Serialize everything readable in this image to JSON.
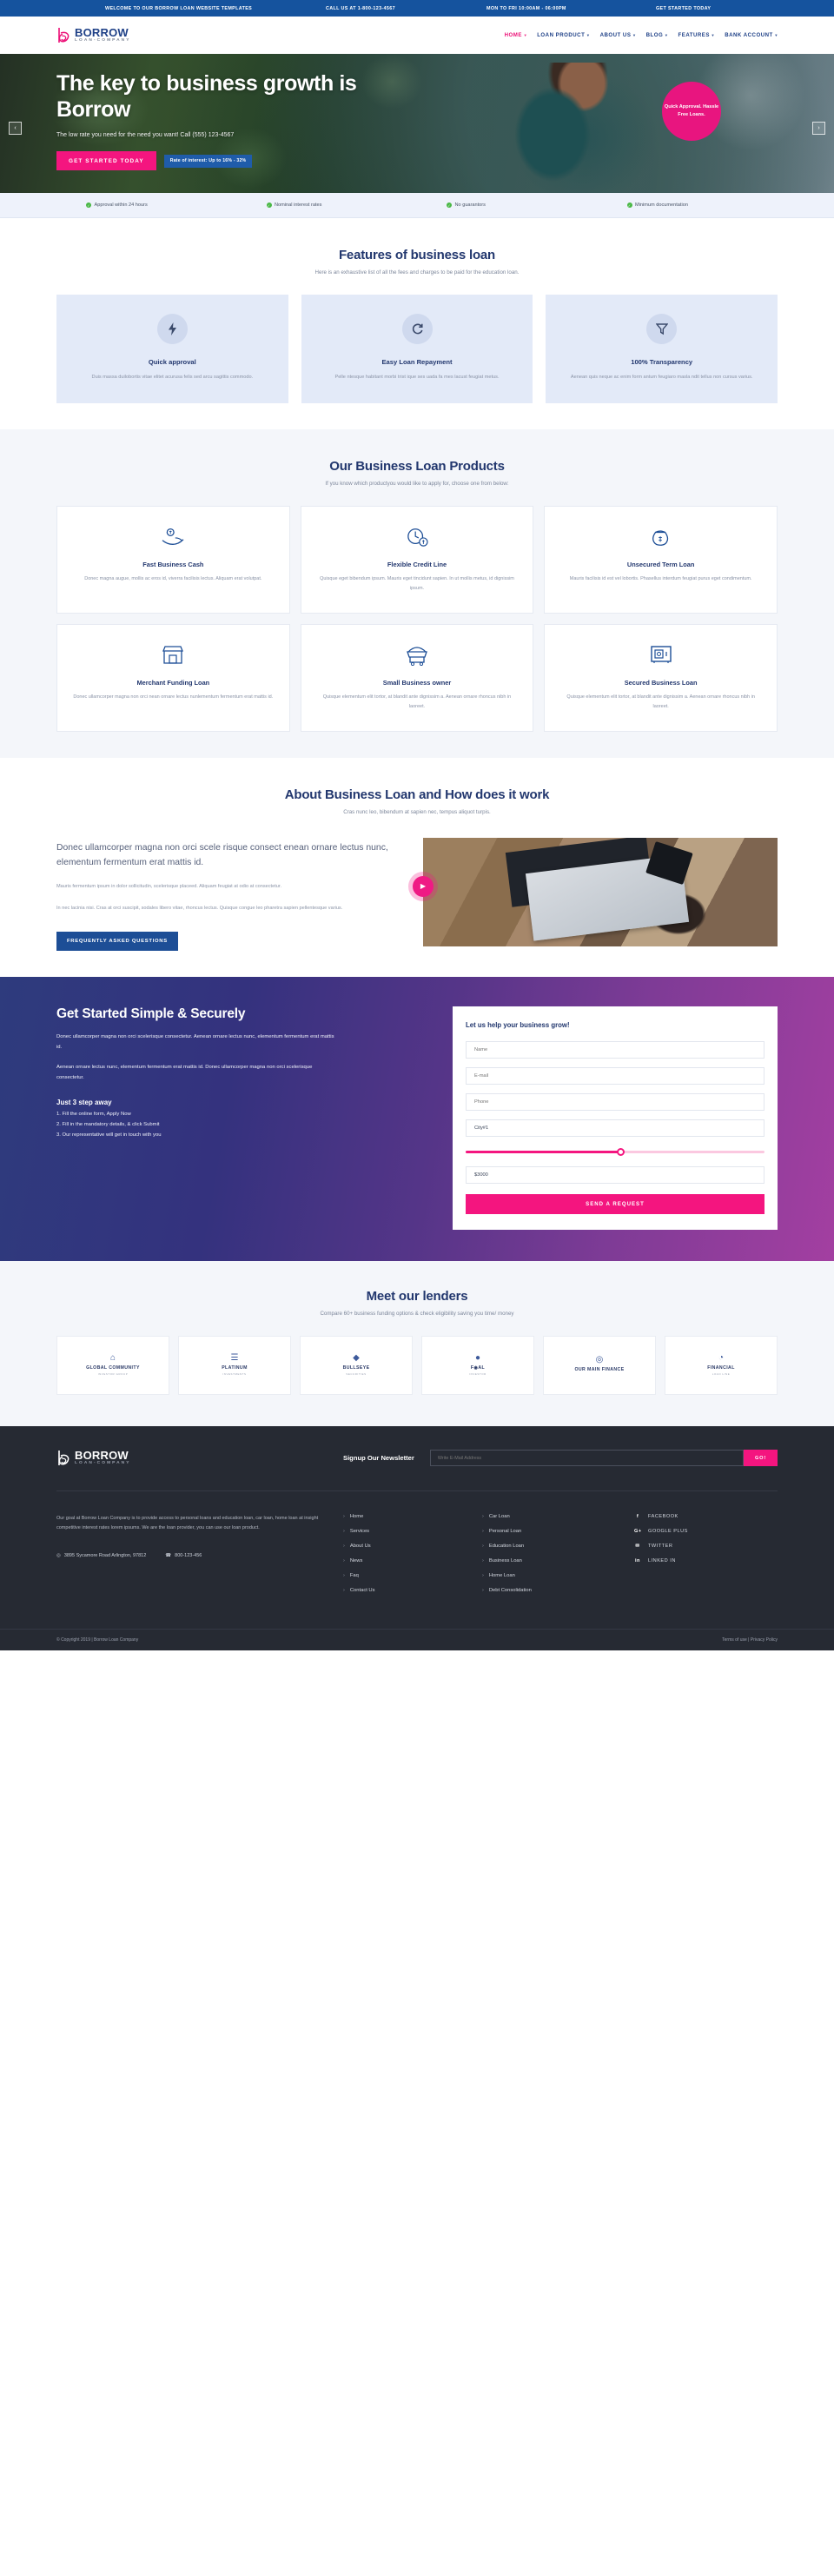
{
  "topbar": {
    "welcome": "WELCOME TO OUR BORROW LOAN WEBSITE TEMPLATES",
    "call": "CALL US AT 1-800-123-4567",
    "hours": "MON TO FRI 10:00AM - 06:00PM",
    "cta": "GET STARTED TODAY"
  },
  "brand": {
    "name": "BORROW",
    "sub": "LOAN-COMPANY"
  },
  "nav": [
    {
      "label": "HOME",
      "caret": "▾",
      "active": true
    },
    {
      "label": "LOAN PRODUCT",
      "caret": "▾",
      "active": false
    },
    {
      "label": "ABOUT US",
      "caret": "▾",
      "active": false
    },
    {
      "label": "BLOG",
      "caret": "▾",
      "active": false
    },
    {
      "label": "FEATURES",
      "caret": "▾",
      "active": false
    },
    {
      "label": "BANK ACCOUNT",
      "caret": "▾",
      "active": false
    }
  ],
  "hero": {
    "title": "The key to business growth is Borrow",
    "subtitle": "The low rate you need for the need you want! Call (555) 123-4567",
    "cta": "GET STARTED TODAY",
    "rate_pill": "Rate of interest: Up to 16% - 32%",
    "badge": "Quick Approval. Hassle Free Loans.",
    "prev_icon": "‹",
    "next_icon": "›"
  },
  "trust": [
    "Approval within 24 hours",
    "Nominal interest rates",
    "No guarantors",
    "Minimum documentation"
  ],
  "features": {
    "title": "Features of business loan",
    "subtitle": "Here is an exhaustive list of all the fees and charges to be paid for the education loan.",
    "cards": [
      {
        "icon": "⚡",
        "name": "Quick approval",
        "desc": "Duis massa duilobortis vitae elitet acurusa felis sed arcu sagittis commodo."
      },
      {
        "icon": "↻",
        "name": "Easy Loan Repayment",
        "desc": "Pelle ntesque habitant morbi trist ique ses uada fa mes lacust feugiat metus."
      },
      {
        "icon": "▽",
        "name": "100% Transparency",
        "desc": "Aenean quis neque ac enim form antum feugiaro masla ndit tellus non cursus varius."
      }
    ]
  },
  "products": {
    "title": "Our Business Loan Products",
    "subtitle": "If you know which productyou would like to apply for, choose one from below:",
    "cards": [
      {
        "icon": "hand-coin-icon",
        "name": "Fast Business Cash",
        "desc": "Donec magna augue, mollis ac eros id, viverra facilisis lectus. Aliquam erat volutpat."
      },
      {
        "icon": "clock-money-icon",
        "name": "Flexible Credit Line",
        "desc": "Quisque eget bibendum ipsum. Mauris eget tincidunt sapien. In ut mollis metus, id dignissim ipsum."
      },
      {
        "icon": "money-bag-icon",
        "name": "Unsecured Term Loan",
        "desc": "Mauris facilisis id est vel lobortis. Phasellus interdum feugiat purus eget condimentum."
      },
      {
        "icon": "shop-icon",
        "name": "Merchant Funding Loan",
        "desc": "Donec ullamcorper magna non orci nean ornare lectus nunlementum fermentum erat mattis id."
      },
      {
        "icon": "food-cart-icon",
        "name": "Small Business owner",
        "desc": "Quisque elementum elit tortor, at blandit ante dignissim a. Aenean ornare rhoncus nibh in laoreet."
      },
      {
        "icon": "safe-icon",
        "name": "Secured Business Loan",
        "desc": "Quisque elementum elit tortor, at blandit ante dignissim a. Aenean ornare rhoncus nibh in laoreet."
      }
    ]
  },
  "about": {
    "title": "About Business Loan and How does it work",
    "subtitle": "Cras nunc leo, bibendum at sapien nec, tempus aliquot turpis.",
    "lead": "Donec ullamcorper magna non orci scele risque consect enean ornare lectus nunc, elementum fermentum erat mattis id.",
    "p1": "Mauris fermentum ipsum in dolor sollicitudin, scelerisque placeed. Aliquam feugiat at odio at consectetur.",
    "p2": "In nec lacinia nisi. Cras at orci suscipit, sodales libero vitae, rhoncus lectus. Quisque congue leo pharetra sapien pellentesque varius.",
    "button": "FREQUENTLY ASKED QUESTIONS",
    "play_icon": "▶"
  },
  "getstarted": {
    "title": "Get Started Simple & Securely",
    "p1": "Donec ullamcorper magna non orci scelerisque consectetur. Aenean ornare lectus nunc, elementum fermentum erat mattis id.",
    "p2": "Aenean ornare lectus nunc, elementum fermentum erat mattis id. Donec ullamcorper magna non orci scelerisque consectetur.",
    "steps_title": "Just 3 step away",
    "steps": [
      "1. Fill the online form, Apply Now",
      "2. Fill in the mandatory details, & click Submit",
      "3. Our representative will get in touch with you"
    ],
    "form": {
      "title": "Let us help your business grow!",
      "name_placeholder": "Name",
      "email_placeholder": "E-mail",
      "phone_placeholder": "Phone",
      "city_value": "City#1",
      "amount_value": "$3000",
      "slider_percent": 52,
      "submit": "SEND A REQUEST"
    }
  },
  "lenders": {
    "title": "Meet our lenders",
    "subtitle": "Compare 60+ business funding options & check eligibility saving you time/ money",
    "items": [
      {
        "mark": "⌂",
        "main": "GLOBAL COMMUNITY",
        "sub": "INVESTOR GROUP"
      },
      {
        "mark": "☰",
        "main": "PLATINUM",
        "sub": "INVESTMENTS"
      },
      {
        "mark": "◆",
        "main": "BULLSEYE",
        "sub": "SECURITIES"
      },
      {
        "mark": "●",
        "main": "F◉AL",
        "sub": "INVESTOR"
      },
      {
        "mark": "◎",
        "main": "OUR MAIN FINANCE",
        "sub": ""
      },
      {
        "mark": "◔",
        "main": "FINANCIAL",
        "sub": "LOAN LINE"
      }
    ]
  },
  "footer": {
    "newsletter_label": "Signup Our Newsletter",
    "newsletter_placeholder": "Write E-Mail Address",
    "newsletter_button": "GO!",
    "about": "Our goal at Borrow Loan Company is to provide access to personal loans and education loan, car loan, home loan at insight competitive interest rates lorem ipsums. We are the loan provider, you can use our loan product.",
    "address": "3895 Sycamore Road Arlington, 97812",
    "phone": "800-123-456",
    "address_icon": "◎",
    "phone_icon": "☎",
    "links_col1": [
      "Home",
      "Services",
      "About Us",
      "News",
      "Faq",
      "Contact Us"
    ],
    "links_col2": [
      "Car Loan",
      "Personal Loan",
      "Education Loan",
      "Business Loan",
      "Home Loan",
      "Debt Consolidation"
    ],
    "social": [
      {
        "icon": "f",
        "label": "FACEBOOK"
      },
      {
        "icon": "G+",
        "label": "GOOGLE PLUS"
      },
      {
        "icon": "✉",
        "label": "TWITTER"
      },
      {
        "icon": "in",
        "label": "LINKED IN"
      }
    ],
    "copyright": "© Copyright 2019 | Borrow Loan Company",
    "terms": "Terms of use",
    "privacy": "Privacy Policy",
    "separator": "|"
  },
  "colors": {
    "brand_blue": "#1d3f86",
    "brand_pink": "#f4157f",
    "topbar_blue": "#15539e",
    "dark": "#262a33"
  }
}
